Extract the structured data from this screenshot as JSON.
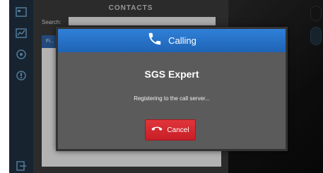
{
  "contacts": {
    "title": "CONTACTS",
    "search_label": "Search:",
    "search_value": "",
    "list_header": "Fi..."
  },
  "dialog": {
    "title": "Calling",
    "contact_name": "SGS Expert",
    "status": "Registering to the call server...",
    "cancel_label": "Cancel"
  },
  "colors": {
    "header_blue": "#2f80d8",
    "cancel_red": "#d9272f",
    "sidebar": "#1f3140"
  },
  "icons": [
    "dashboard-icon",
    "chart-icon",
    "settings-icon",
    "info-icon",
    "exit-icon",
    "phone-icon",
    "hang-up-icon"
  ]
}
